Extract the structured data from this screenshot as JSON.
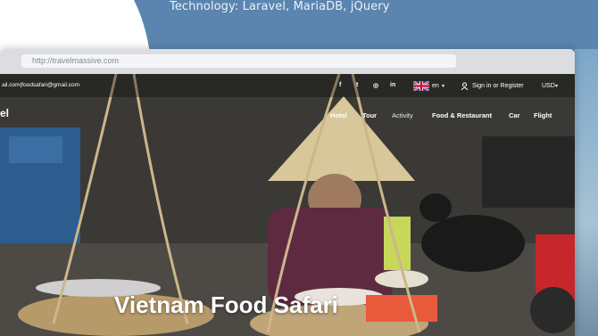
{
  "caption": "Technology: Laravel, MariaDB, jQuery",
  "browser": {
    "url": "http://travelmassive.com"
  },
  "site": {
    "email": "ail.com|foodsafari@gmail.com",
    "logo_fragment": "el",
    "social_icons": [
      "facebook-icon",
      "twitter-icon",
      "instagram-icon",
      "linkedin-icon"
    ],
    "social_glyphs": [
      "f",
      "t",
      "◎",
      "in"
    ],
    "language": "en",
    "language_caret": "▾",
    "account": "Sign in or Register",
    "currency": "USD",
    "currency_caret": "▾",
    "menu": [
      "Hotel",
      "Tour",
      "Activity",
      "Food & Restaurant",
      "Car",
      "Flight"
    ],
    "hero_title": "Vietnam Food Safari"
  }
}
